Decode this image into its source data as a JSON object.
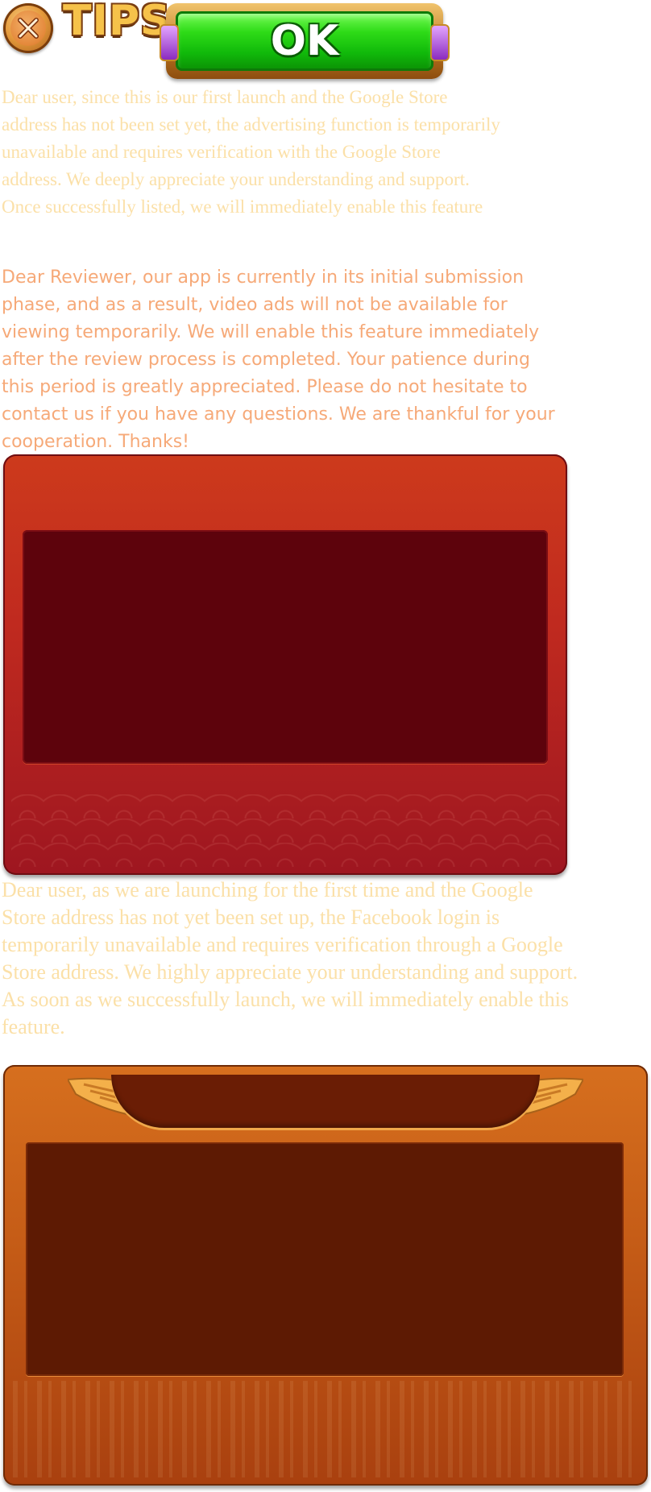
{
  "header": {
    "close_icon": "close-x-icon",
    "tips_label": "TIPS",
    "ok_label": "OK"
  },
  "notices": {
    "first_launch_ads": "Dear user, since this is our first launch and the Google Store address has not been set yet, the advertising function is temporarily unavailable and requires verification with the Google Store address. We deeply appreciate your understanding and support. Once successfully listed, we will immediately enable this feature",
    "reviewer_message": "Dear Reviewer, our app is currently in its initial submission phase, and as a result, video ads will not be available for viewing temporarily. We will enable this feature immediately after the review process is completed. Your patience during this period is greatly appreciated. Please do not hesitate to contact us if you have any questions. We are thankful for your cooperation. Thanks!",
    "facebook_login": "Dear user, as we are launching for the first time and the Google Store address has not yet been set up, the Facebook login is temporarily unavailable and requires verification through a Google Store address. We highly appreciate your understanding and support. As soon as we successfully launch, we will immediately enable this feature."
  },
  "colors": {
    "notice_pale": "#fbe0a8",
    "notice_salmon": "#f6a978",
    "ok_green": "#2edb17",
    "red_panel": "#c02a1f",
    "orange_panel": "#c65d17"
  }
}
